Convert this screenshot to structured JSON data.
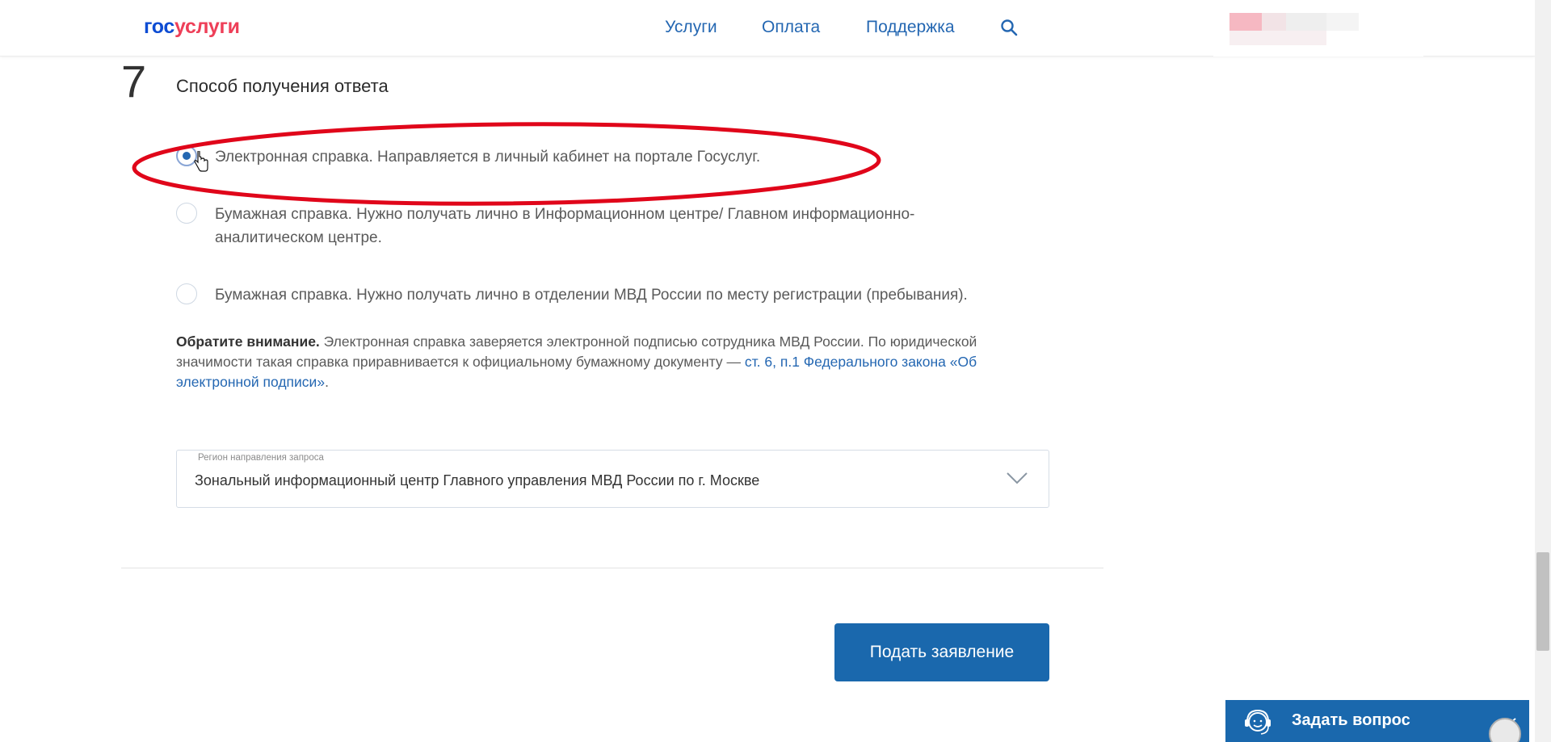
{
  "header": {
    "logo": {
      "part1": "гос",
      "part2": "услуги"
    },
    "nav": [
      {
        "label": "Услуги"
      },
      {
        "label": "Оплата"
      },
      {
        "label": "Поддержка"
      }
    ],
    "search_icon": "search-icon"
  },
  "step": {
    "number": "7",
    "title": "Способ получения ответа"
  },
  "options": [
    {
      "label": "Электронная справка. Направляется в личный кабинет на портале Госуслуг.",
      "checked": true
    },
    {
      "label": "Бумажная справка. Нужно получать лично в Информационном центре/ Главном информационно-аналитическом центре.",
      "checked": false
    },
    {
      "label": "Бумажная справка. Нужно получать лично в отделении МВД России по месту регистрации (пребывания).",
      "checked": false
    }
  ],
  "notice": {
    "bold": "Обратите внимание.",
    "text": " Электронная справка заверяется электронной подписью сотрудника МВД России. По юридической значимости такая справка приравнивается к официальному бумажному документу — ",
    "link": "ст. 6, п.1 Федерального закона «Об электронной подписи»",
    "end": "."
  },
  "region_select": {
    "label": "Регион направления запроса",
    "value": "Зональный информационный центр Главного управления МВД России по г. Москве"
  },
  "submit_button": "Подать заявление",
  "help_widget": {
    "label": "Задать вопрос"
  },
  "colors": {
    "brand_blue": "#0d4cd3",
    "brand_red": "#ee3f58",
    "link_blue": "#2467b2",
    "button_blue": "#1a68ad",
    "annotation_red": "#e0061a"
  }
}
